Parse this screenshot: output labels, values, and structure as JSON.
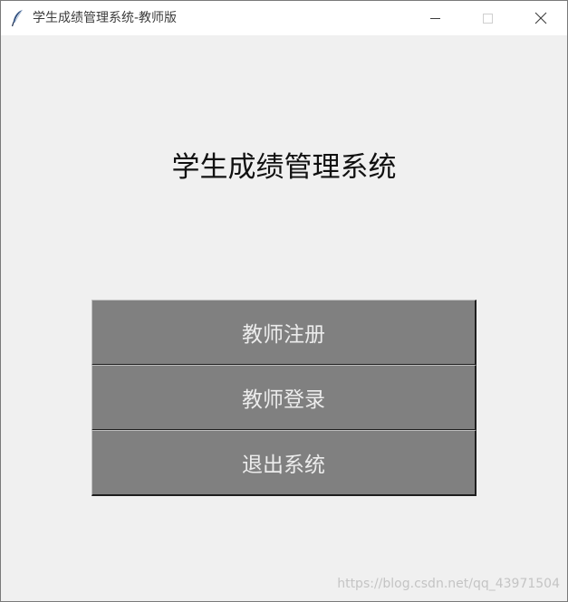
{
  "window": {
    "title": "学生成绩管理系统-教师版",
    "icon": "feather-icon",
    "controls": {
      "minimize_icon": "minimize-icon",
      "maximize_icon": "maximize-icon",
      "close_icon": "close-icon"
    }
  },
  "main": {
    "heading": "学生成绩管理系统",
    "buttons": [
      {
        "label": "教师注册"
      },
      {
        "label": "教师登录"
      },
      {
        "label": "退出系统"
      }
    ]
  },
  "watermark": "https://blog.csdn.net/qq_43971504",
  "colors": {
    "window_background": "#f0f0f0",
    "button_background": "#808080",
    "button_text": "#ececec"
  }
}
